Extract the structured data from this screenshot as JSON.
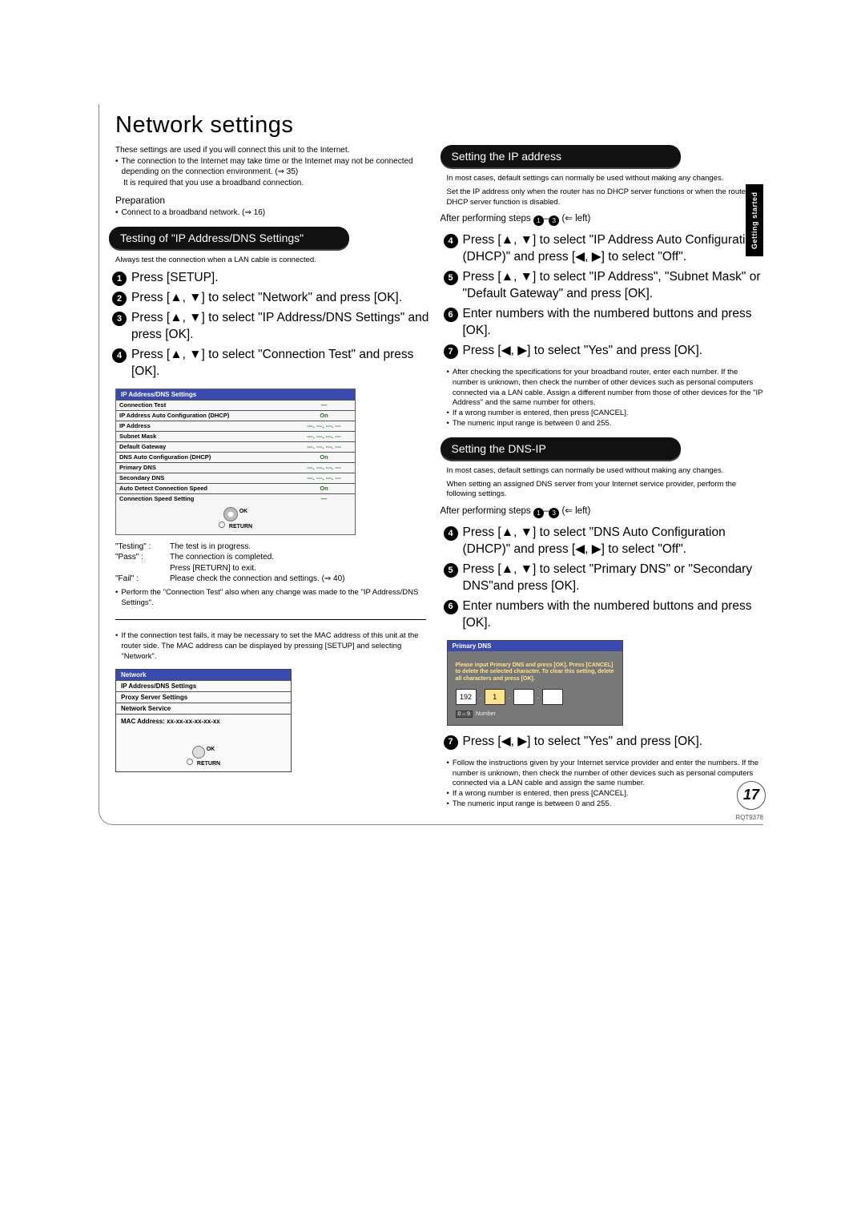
{
  "page": {
    "title": "Network settings",
    "sideTab": "Getting started",
    "number": "17",
    "docCode": "RQT9378"
  },
  "intro": {
    "line1": "These settings are used if you will connect this unit to the Internet.",
    "line2a": "The connection to the Internet may take time or the Internet may not be connected depending on the connection environment. (⇒ 35)",
    "line2b": "It is required that you use a broadband connection."
  },
  "prep": {
    "label": "Preparation",
    "item": "Connect to a broadband network. (⇒ 16)"
  },
  "section1": {
    "title": "Testing of \"IP Address/DNS Settings\"",
    "note": "Always test the connection when a LAN cable is connected.",
    "steps": [
      "Press [SETUP].",
      "Press [▲, ▼] to select \"Network\" and press [OK].",
      "Press [▲, ▼] to select \"IP Address/DNS Settings\" and press [OK].",
      "Press [▲, ▼] to select \"Connection Test\" and press [OK]."
    ],
    "table": {
      "header": "IP Address/DNS Settings",
      "rows": [
        {
          "k": "Connection Test",
          "v": "—"
        },
        {
          "k": "IP Address Auto Configuration (DHCP)",
          "v": "On"
        },
        {
          "k": "IP Address",
          "v": "---. ---. ---. ---"
        },
        {
          "k": "Subnet Mask",
          "v": "---. ---. ---. ---"
        },
        {
          "k": "Default Gateway",
          "v": "---. ---. ---. ---"
        },
        {
          "k": "DNS Auto Configuration (DHCP)",
          "v": "On"
        },
        {
          "k": "Primary DNS",
          "v": "---. ---. ---. ---"
        },
        {
          "k": "Secondary DNS",
          "v": "---. ---. ---. ---"
        },
        {
          "k": "Auto Detect Connection Speed",
          "v": "On"
        },
        {
          "k": "Connection Speed Setting",
          "v": "—"
        }
      ],
      "ctrl_ok": "OK",
      "ctrl_return": "RETURN"
    },
    "defs": [
      {
        "k": "\"Testing\" :",
        "v": "The test is in progress."
      },
      {
        "k": "\"Pass\" :",
        "v": "The connection is completed."
      },
      {
        "k": "",
        "v": "Press [RETURN] to exit."
      },
      {
        "k": "\"Fail\" :",
        "v": "Please check the connection and settings. (⇒ 40)"
      }
    ],
    "bullet1": "Perform the \"Connection Test\" also when any change was made to the \"IP Address/DNS Settings\".",
    "footnote": "If the connection test fails, it may be necessary to set the MAC address of this unit at the router side. The MAC address can be displayed by pressing [SETUP] and selecting \"Network\".",
    "netbox": {
      "header": "Network",
      "rows": [
        "IP Address/DNS Settings",
        "Proxy Server Settings",
        "Network Service"
      ],
      "mac": "MAC Address: xx-xx-xx-xx-xx-xx",
      "ctrl_ok": "OK",
      "ctrl_return": "RETURN"
    }
  },
  "section2": {
    "title": "Setting the IP address",
    "note1": "In most cases, default settings can normally be used without making any changes.",
    "note2": "Set the IP address only when the router has no DHCP server functions or when the router's DHCP server function is disabled.",
    "after": "After performing steps",
    "afterTail": "(⇐ left)",
    "steps": [
      {
        "n": "4",
        "t": "Press [▲, ▼] to select \"IP Address Auto Configuration (DHCP)\" and press [◀, ▶] to select \"Off\"."
      },
      {
        "n": "5",
        "t": "Press [▲, ▼] to select \"IP Address\", \"Subnet Mask\" or \"Default Gateway\" and press [OK]."
      },
      {
        "n": "6",
        "t": "Enter numbers with the numbered buttons and press [OK]."
      },
      {
        "n": "7",
        "t": "Press [◀, ▶] to select \"Yes\" and press [OK]."
      }
    ],
    "bullets": [
      "After checking the specifications for your broadband router, enter each number. If the number is unknown, then check the number of other devices such as personal computers connected via a LAN cable. Assign a different number from those of other devices for the \"IP Address\" and the same number for others.",
      "If a wrong number is entered, then press [CANCEL].",
      "The numeric input range is between 0 and 255."
    ]
  },
  "section3": {
    "title": "Setting the DNS-IP",
    "note1": "In most cases, default settings can normally be used without making any changes.",
    "note2": "When setting an assigned DNS server from your Internet service provider, perform the following settings.",
    "after": "After performing steps",
    "afterTail": "(⇐ left)",
    "steps": [
      {
        "n": "4",
        "t": "Press [▲, ▼] to select \"DNS Auto Configuration (DHCP)\" and press [◀, ▶] to select \"Off\"."
      },
      {
        "n": "5",
        "t": "Press [▲, ▼] to select \"Primary DNS\" or \"Secondary DNS\"and press [OK]."
      },
      {
        "n": "6",
        "t": "Enter numbers with the numbered buttons and press [OK]."
      }
    ],
    "dnsbox": {
      "header": "Primary DNS",
      "msg": "Please input Primary DNS and press [OK]. Press [CANCEL] to delete the selected character. To clear this setting, delete all characters and press [OK].",
      "f1": "192",
      "f2": "1",
      "hint_k": "0 – 9",
      "hint_v": "Number"
    },
    "step7": {
      "n": "7",
      "t": "Press [◀, ▶] to select \"Yes\" and press [OK]."
    },
    "bullets": [
      "Follow the instructions given by your Internet service provider and enter the numbers. If the number is unknown, then check the number of other devices such as personal computers connected via a LAN cable and assign the same number.",
      "If a wrong number is entered, then press [CANCEL].",
      "The numeric input range is between 0 and 255."
    ]
  }
}
